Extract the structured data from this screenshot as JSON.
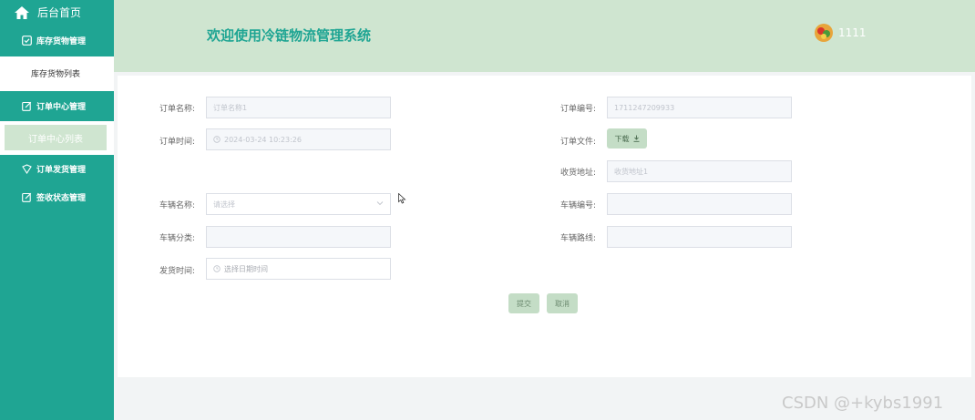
{
  "sidebar": {
    "home_label": "后台首页",
    "menus": [
      {
        "title": "库存货物管理",
        "icon": "checkbox-icon"
      },
      {
        "title": "订单中心管理",
        "icon": "edit-icon"
      },
      {
        "title": "订单发货管理",
        "icon": "shield-icon"
      },
      {
        "title": "签收状态管理",
        "icon": "edit-icon"
      }
    ],
    "sub_items": {
      "inventory_list": "库存货物列表",
      "order_list": "订单中心列表"
    }
  },
  "header": {
    "title": "欢迎使用冷链物流管理系统",
    "username": "1111"
  },
  "form": {
    "order_name": {
      "label": "订单名称:",
      "placeholder": "订单名称1"
    },
    "order_no": {
      "label": "订单编号:",
      "value": "1711247209933"
    },
    "order_time": {
      "label": "订单时间:",
      "value": "2024-03-24 10:23:26"
    },
    "order_file": {
      "label": "订单文件:",
      "button": "下载"
    },
    "address": {
      "label": "收货地址:",
      "placeholder": "收货地址1"
    },
    "vehicle_name": {
      "label": "车辆名称:",
      "placeholder": "请选择"
    },
    "vehicle_no": {
      "label": "车辆编号:",
      "value": ""
    },
    "vehicle_cat": {
      "label": "车辆分类:",
      "value": ""
    },
    "vehicle_route": {
      "label": "车辆路线:",
      "value": ""
    },
    "ship_time": {
      "label": "发货时间:",
      "placeholder": "选择日期时间"
    }
  },
  "actions": {
    "submit": "提交",
    "cancel": "取消"
  },
  "watermark": "CSDN @+kybs1991",
  "colors": {
    "primary": "#1fa593",
    "header_bg": "#cfe5d0",
    "button_bg": "#c4ddc6"
  }
}
